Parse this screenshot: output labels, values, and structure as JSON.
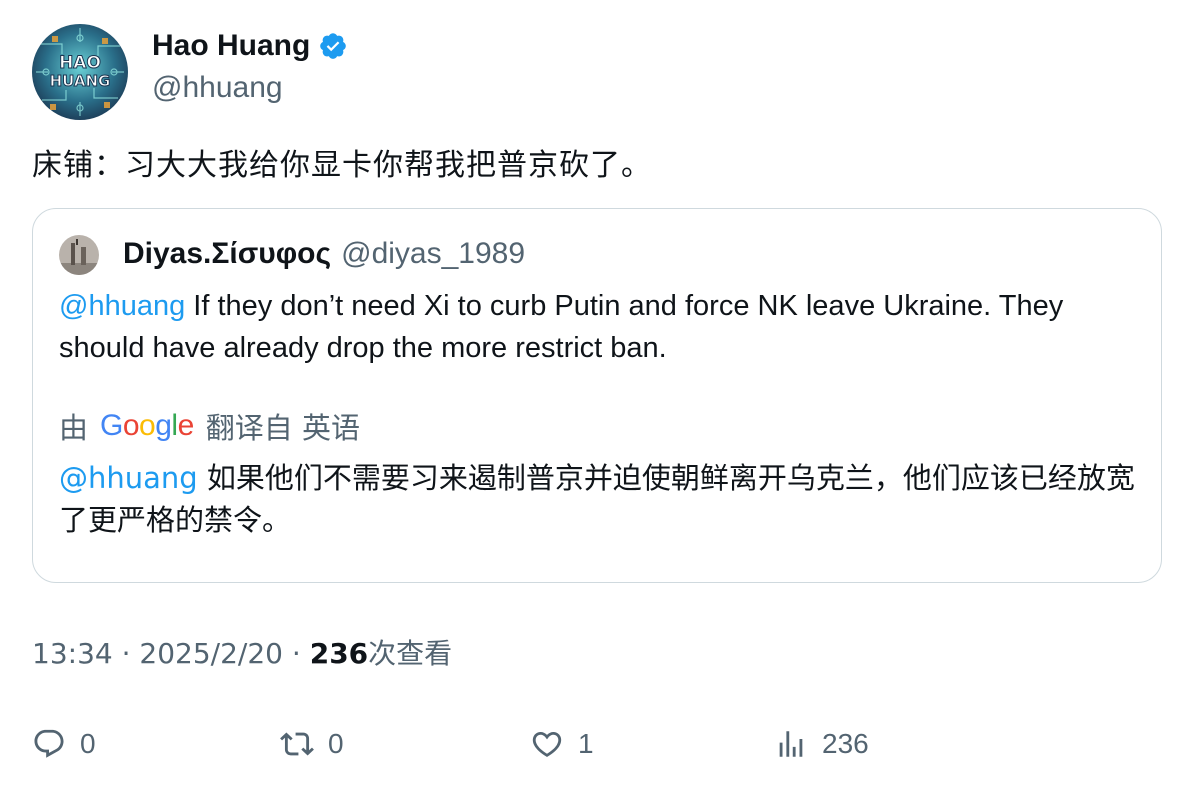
{
  "author": {
    "display_name": "Hao Huang",
    "handle": "@hhuang",
    "verified": true,
    "avatar_text": "HAO HUANG"
  },
  "tweet": {
    "text": "床铺：习大大我给你显卡你帮我把普京砍了。"
  },
  "quote": {
    "display_name": "Diyas.Σίσυφος",
    "handle": "@diyas_1989",
    "mention": "@hhuang",
    "text": "If they don’t need Xi to curb Putin and force NK leave Ukraine. They should have already drop the more restrict ban.",
    "translate_prefix": "由",
    "translate_provider": "Google",
    "translate_suffix": "翻译自 英语",
    "translated_mention": "@hhuang",
    "translated_text": "如果他们不需要习来遏制普京并迫使朝鲜离开乌克兰，他们应该已经放宽了更严格的禁令。"
  },
  "meta": {
    "time": "13:34",
    "date": "2025/2/20",
    "sep": "·",
    "views_count": "236",
    "views_label": "次查看"
  },
  "actions": {
    "replies": "0",
    "retweets": "0",
    "likes": "1",
    "views": "236"
  },
  "colors": {
    "link": "#1d9bf0",
    "secondary_text": "#536471",
    "border": "#cfd9de",
    "verified": "#1d9bf0"
  }
}
